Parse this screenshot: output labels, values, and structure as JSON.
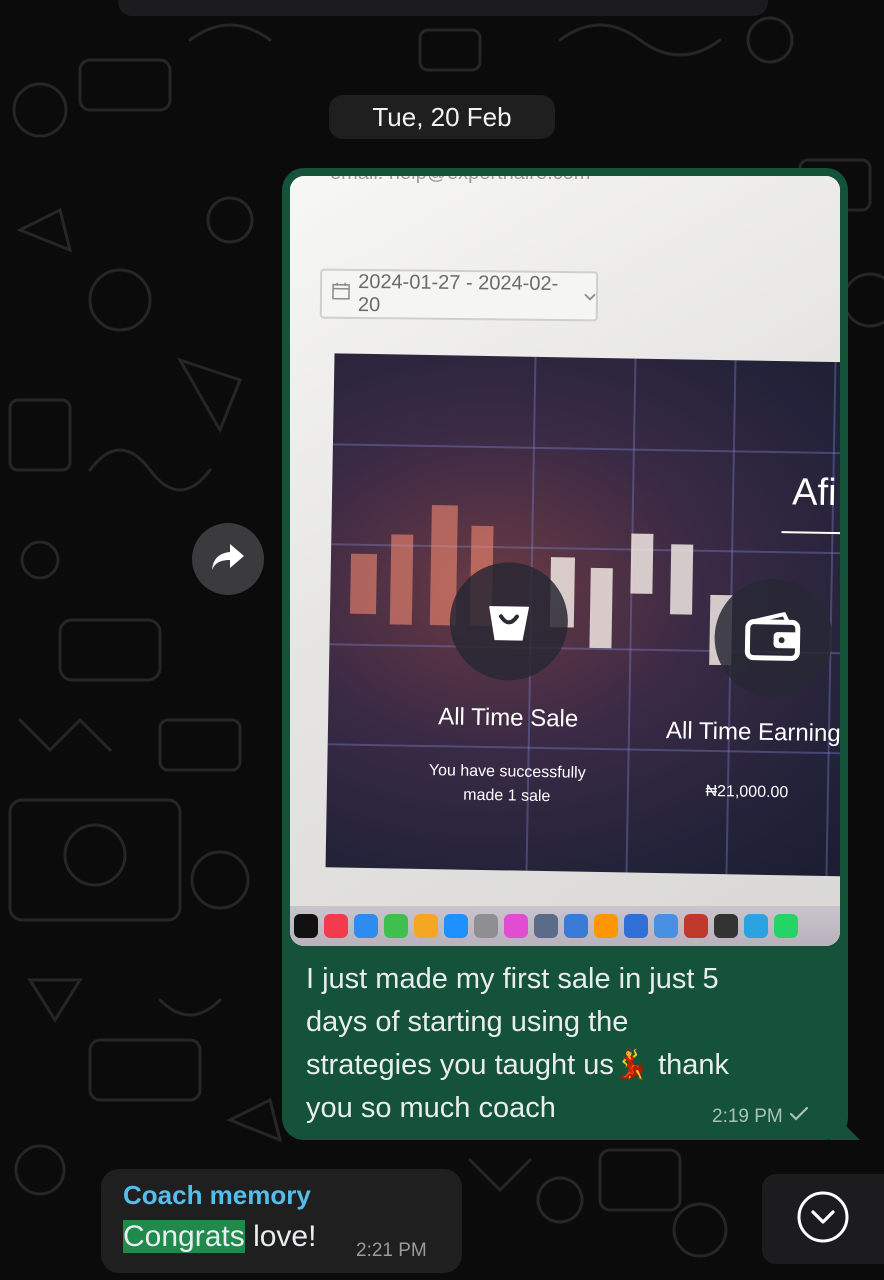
{
  "chat": {
    "date_separator": "Tue, 20 Feb"
  },
  "outgoing_message": {
    "image": {
      "email_text": "email: help@experthaire.com",
      "date_range": "2024-01-27 - 2024-02-20",
      "heading_partial": "Afi",
      "stat1_title": "All Time Sale",
      "stat1_subtitle_line1": "You have successfully",
      "stat1_subtitle_line2": "made 1 sale",
      "stat2_title": "All Time Earning",
      "stat2_value": "₦21,000.00"
    },
    "text_line1": "I just made my first sale in just 5",
    "text_line2": "days of starting using the",
    "text_line3_before_emoji": "strategies you taught us",
    "emoji": "💃",
    "text_line3_after_emoji": " thank",
    "text_line4": "you so much coach",
    "time": "2:19 PM",
    "status_icon": "single-check-icon"
  },
  "incoming_message": {
    "sender": "Coach memory",
    "highlighted_word": "Congrats",
    "text_rest": " love!",
    "time": "2:21 PM"
  },
  "colors": {
    "outgoing_bubble": "#145239",
    "incoming_bubble": "#1f1f1f",
    "sender_name": "#53bdeb",
    "highlight": "#1f8a4c"
  },
  "icons": {
    "forward": "forward-icon",
    "scroll_down": "chevron-down-icon"
  }
}
